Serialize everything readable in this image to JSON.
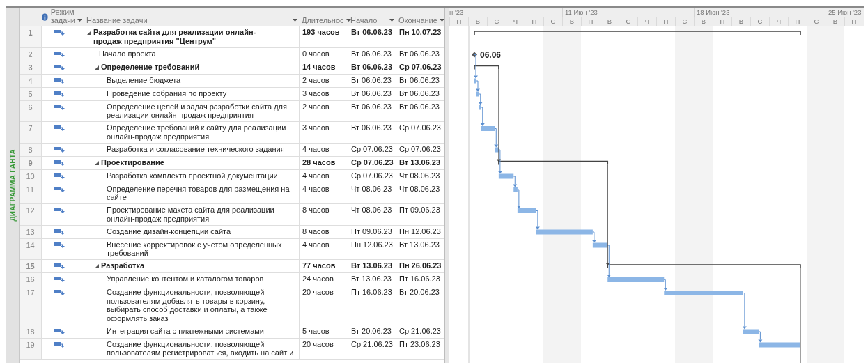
{
  "view_label": "ДИАГРАММА ГАНТА",
  "columns": {
    "mode": "Режим задачи",
    "name": "Название задачи",
    "duration": "Длительнос",
    "start": "Начало",
    "finish": "Окончание"
  },
  "timescale": {
    "weeks": [
      "н '23",
      "11 Июн '23",
      "18 Июн '23",
      "25 Июн '23"
    ],
    "days": [
      {
        "label": "П",
        "nonworking": false
      },
      {
        "label": "В",
        "nonworking": false
      },
      {
        "label": "С",
        "nonworking": false
      },
      {
        "label": "Ч",
        "nonworking": false
      },
      {
        "label": "П",
        "nonworking": false
      },
      {
        "label": "С",
        "nonworking": true
      },
      {
        "label": "В",
        "nonworking": true
      },
      {
        "label": "П",
        "nonworking": false
      },
      {
        "label": "В",
        "nonworking": false
      },
      {
        "label": "С",
        "nonworking": false
      },
      {
        "label": "Ч",
        "nonworking": false
      },
      {
        "label": "П",
        "nonworking": false
      },
      {
        "label": "С",
        "nonworking": true
      },
      {
        "label": "В",
        "nonworking": true
      },
      {
        "label": "П",
        "nonworking": false
      },
      {
        "label": "В",
        "nonworking": false
      },
      {
        "label": "С",
        "nonworking": false
      },
      {
        "label": "Ч",
        "nonworking": false
      },
      {
        "label": "П",
        "nonworking": false
      },
      {
        "label": "С",
        "nonworking": true
      },
      {
        "label": "В",
        "nonworking": true
      },
      {
        "label": "П",
        "nonworking": false
      }
    ]
  },
  "tasks": [
    {
      "number": "1",
      "kind": "summary",
      "expanded": true,
      "name": "Разработка сайта для реализации онлайн-продаж предприятия \"Центрум\"",
      "duration": "193 часов",
      "start": "Вт 06.06.23",
      "finish": "Пн 10.07.23",
      "children": [
        {
          "number": "2",
          "kind": "milestone",
          "name": "Начало проекта",
          "duration": "0 часов",
          "start": "Вт 06.06.23",
          "finish": "Вт 06.06.23",
          "milestone_label": "06.06"
        },
        {
          "number": "3",
          "kind": "summary",
          "expanded": true,
          "name": "Определение требований",
          "duration": "14 часов",
          "start": "Вт 06.06.23",
          "finish": "Ср 07.06.23",
          "children": [
            {
              "number": "4",
              "kind": "task",
              "name": "Выделение бюджета",
              "duration": "2 часов",
              "start": "Вт 06.06.23",
              "finish": "Вт 06.06.23"
            },
            {
              "number": "5",
              "kind": "task",
              "name": "Проведение собрания по проекту",
              "duration": "3 часов",
              "start": "Вт 06.06.23",
              "finish": "Вт 06.06.23"
            },
            {
              "number": "6",
              "kind": "task",
              "name": "Определение целей и задач разработки сайта для реализации онлайн-продаж предприятия",
              "duration": "2 часов",
              "start": "Вт 06.06.23",
              "finish": "Вт 06.06.23"
            },
            {
              "number": "7",
              "kind": "task",
              "name": "Определение требований к сайту для реализации онлайн-продаж предприятия",
              "duration": "3 часов",
              "start": "Вт 06.06.23",
              "finish": "Ср 07.06.23"
            },
            {
              "number": "8",
              "kind": "task",
              "name": "Разработка и согласование технического задания",
              "duration": "4 часов",
              "start": "Ср 07.06.23",
              "finish": "Ср 07.06.23"
            }
          ]
        },
        {
          "number": "9",
          "kind": "summary",
          "expanded": true,
          "name": "Проектирование",
          "duration": "28 часов",
          "start": "Ср 07.06.23",
          "finish": "Вт 13.06.23",
          "children": [
            {
              "number": "10",
              "kind": "task",
              "name": "Разработка комплекта проектной документации",
              "duration": "4 часов",
              "start": "Ср 07.06.23",
              "finish": "Чт 08.06.23"
            },
            {
              "number": "11",
              "kind": "task",
              "name": "Определение перечня товаров для размещения на сайте",
              "duration": "4 часов",
              "start": "Чт 08.06.23",
              "finish": "Чт 08.06.23"
            },
            {
              "number": "12",
              "kind": "task",
              "name": "Проектирование макета сайта для реализации онлайн-продаж предприятия",
              "duration": "8 часов",
              "start": "Чт 08.06.23",
              "finish": "Пт 09.06.23"
            },
            {
              "number": "13",
              "kind": "task",
              "name": "Создание дизайн-концепции сайта",
              "duration": "8 часов",
              "start": "Пт 09.06.23",
              "finish": "Пн 12.06.23"
            },
            {
              "number": "14",
              "kind": "task",
              "name": "Внесение корректировок с учетом определенных требований",
              "duration": "4 часов",
              "start": "Пн 12.06.23",
              "finish": "Вт 13.06.23"
            }
          ]
        },
        {
          "number": "15",
          "kind": "summary",
          "expanded": true,
          "name": "Разработка",
          "duration": "77 часов",
          "start": "Вт 13.06.23",
          "finish": "Пн 26.06.23",
          "children": [
            {
              "number": "16",
              "kind": "task",
              "name": "Управление контентом и каталогом товаров",
              "duration": "24 часов",
              "start": "Вт 13.06.23",
              "finish": "Пт 16.06.23"
            },
            {
              "number": "17",
              "kind": "task",
              "name": "Создание функциональности, позволяющей пользователям добавлять товары в корзину, выбирать способ доставки и оплаты, а также оформлять заказ",
              "duration": "20 часов",
              "start": "Пт 16.06.23",
              "finish": "Вт 20.06.23"
            },
            {
              "number": "18",
              "kind": "task",
              "name": "Интеграция сайта с платежными системами",
              "duration": "5 часов",
              "start": "Вт 20.06.23",
              "finish": "Ср 21.06.23"
            },
            {
              "number": "19",
              "kind": "task",
              "name": "Создание функциональности, позволяющей пользователям регистрироваться, входить на сайт и",
              "duration": "20 часов",
              "start": "Ср 21.06.23",
              "finish": "Пт 23.06.23"
            }
          ]
        }
      ]
    }
  ]
}
